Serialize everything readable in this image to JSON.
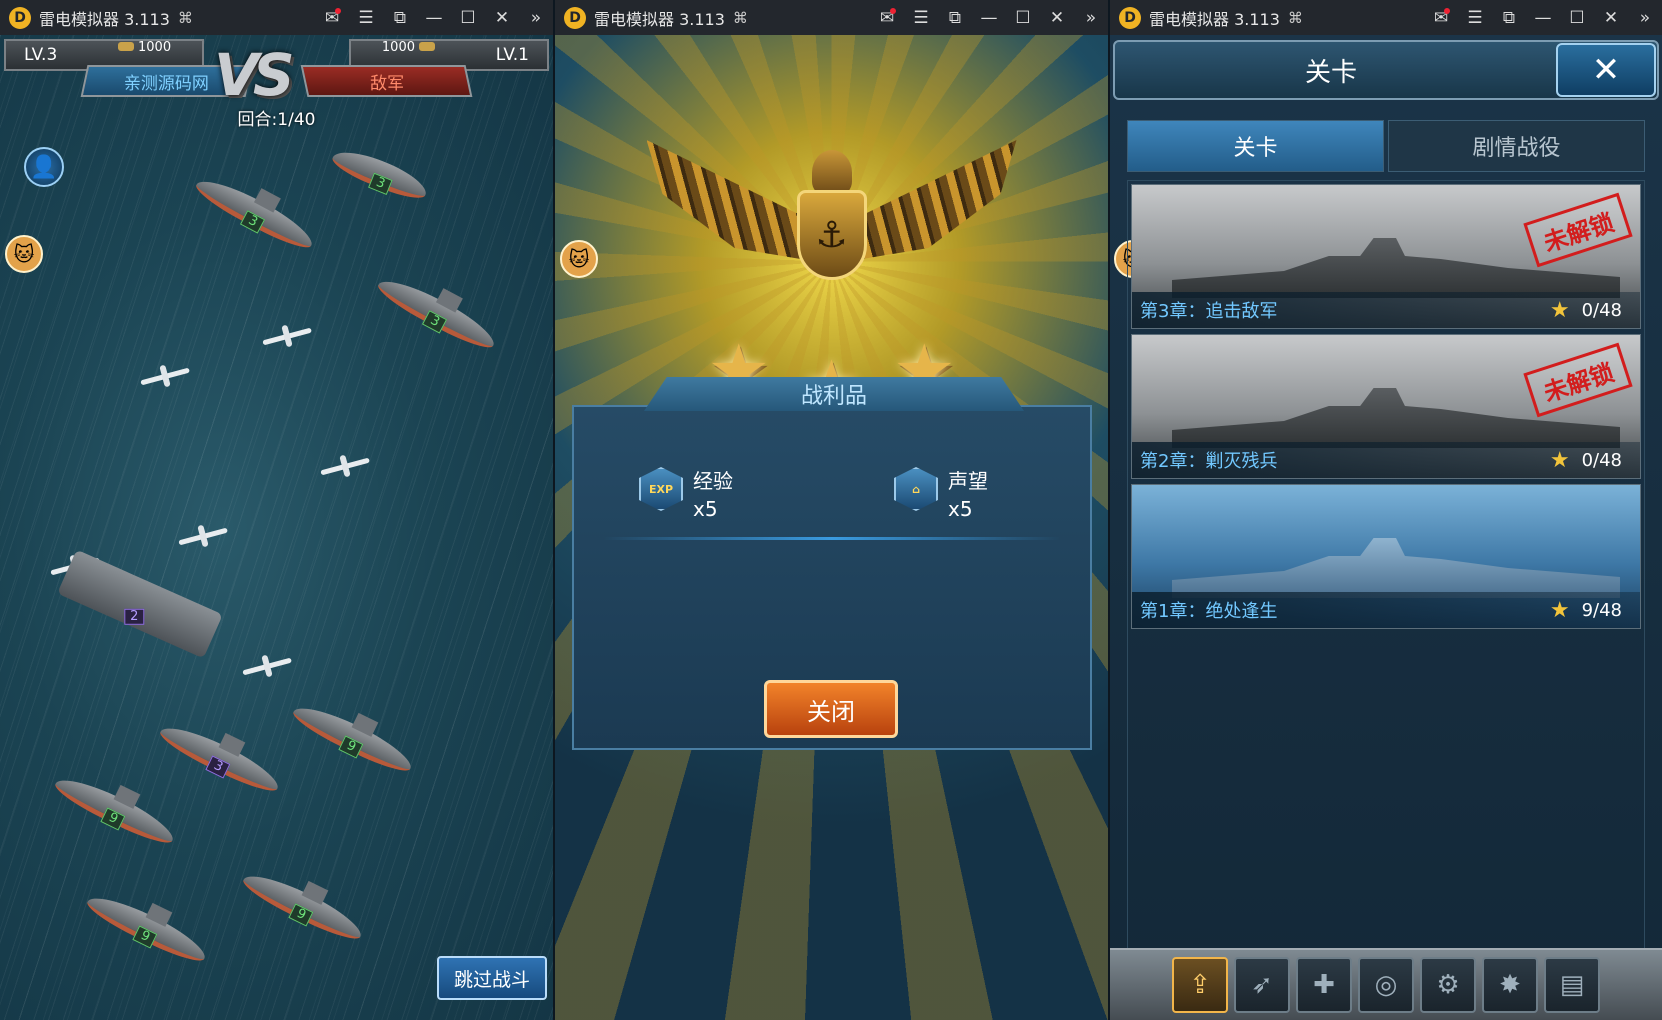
{
  "emulator_title": "雷电模拟器 3.113",
  "battle": {
    "player_level": "LV.3",
    "enemy_level": "LV.1",
    "player_gold": "1000",
    "enemy_gold": "1000",
    "player_name": "亲测源码网",
    "enemy_name": "敌军",
    "vs_text": "VS",
    "round": "回合:1/40",
    "skip_label": "跳过战斗",
    "unit_levels": [
      "3",
      "3",
      "3",
      "3",
      "2",
      "3",
      "9",
      "9",
      "9",
      "9"
    ]
  },
  "victory": {
    "loot_title": "战利品",
    "rewards": [
      {
        "icon": "exp-icon",
        "icon_text": "EXP",
        "label": "经验",
        "amount": "x5"
      },
      {
        "icon": "prestige-icon",
        "label": "声望",
        "amount": "x5"
      }
    ],
    "close_label": "关闭",
    "stars_earned": 3
  },
  "stages": {
    "header_title": "关卡",
    "close_glyph": "✕",
    "tabs": [
      {
        "label": "关卡",
        "active": true
      },
      {
        "label": "剧情战役",
        "active": false
      }
    ],
    "items": [
      {
        "name": "第3章：追击敌军",
        "progress": "0/48",
        "locked": true,
        "lock_label": "未解锁"
      },
      {
        "name": "第2章：剿灭残兵",
        "progress": "0/48",
        "locked": true,
        "lock_label": "未解锁"
      },
      {
        "name": "第1章：绝处逢生",
        "progress": "9/48",
        "locked": false
      }
    ],
    "toolbar_icons": [
      "upgrade-icon",
      "shell-icon",
      "repair-icon",
      "radar-icon",
      "engine-icon",
      "explosion-icon",
      "manual-icon"
    ]
  },
  "colors": {
    "player_blue": "#7fd0ff",
    "enemy_red": "#ff8a6a",
    "stage_name": "#72c8ff",
    "locked_stamp": "#d21d1d",
    "close_button": "#f2832a"
  }
}
